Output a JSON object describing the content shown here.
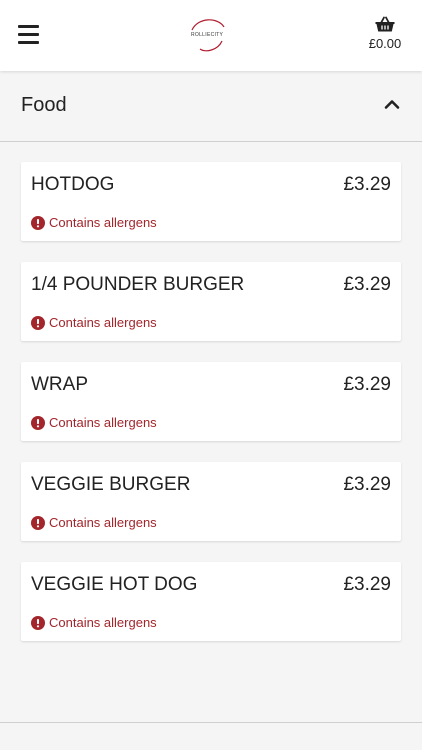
{
  "header": {
    "brand": "ROLLIECITY",
    "basket_total": "£0.00"
  },
  "section": {
    "title": "Food",
    "expanded": true
  },
  "items": [
    {
      "name": "HOTDOG",
      "price": "£3.29",
      "allergen_text": "Contains allergens"
    },
    {
      "name": "1/4 POUNDER BURGER",
      "price": "£3.29",
      "allergen_text": "Contains allergens"
    },
    {
      "name": "WRAP",
      "price": "£3.29",
      "allergen_text": "Contains allergens"
    },
    {
      "name": "VEGGIE BURGER",
      "price": "£3.29",
      "allergen_text": "Contains allergens"
    },
    {
      "name": "VEGGIE HOT DOG",
      "price": "£3.29",
      "allergen_text": "Contains allergens"
    }
  ],
  "colors": {
    "allergen": "#a3262c",
    "brand_accent": "#b01c2e"
  },
  "icons": {
    "menu": "hamburger-menu-icon",
    "basket": "basket-icon",
    "collapse": "chevron-up-icon",
    "allergen": "exclamation-circle-icon"
  }
}
